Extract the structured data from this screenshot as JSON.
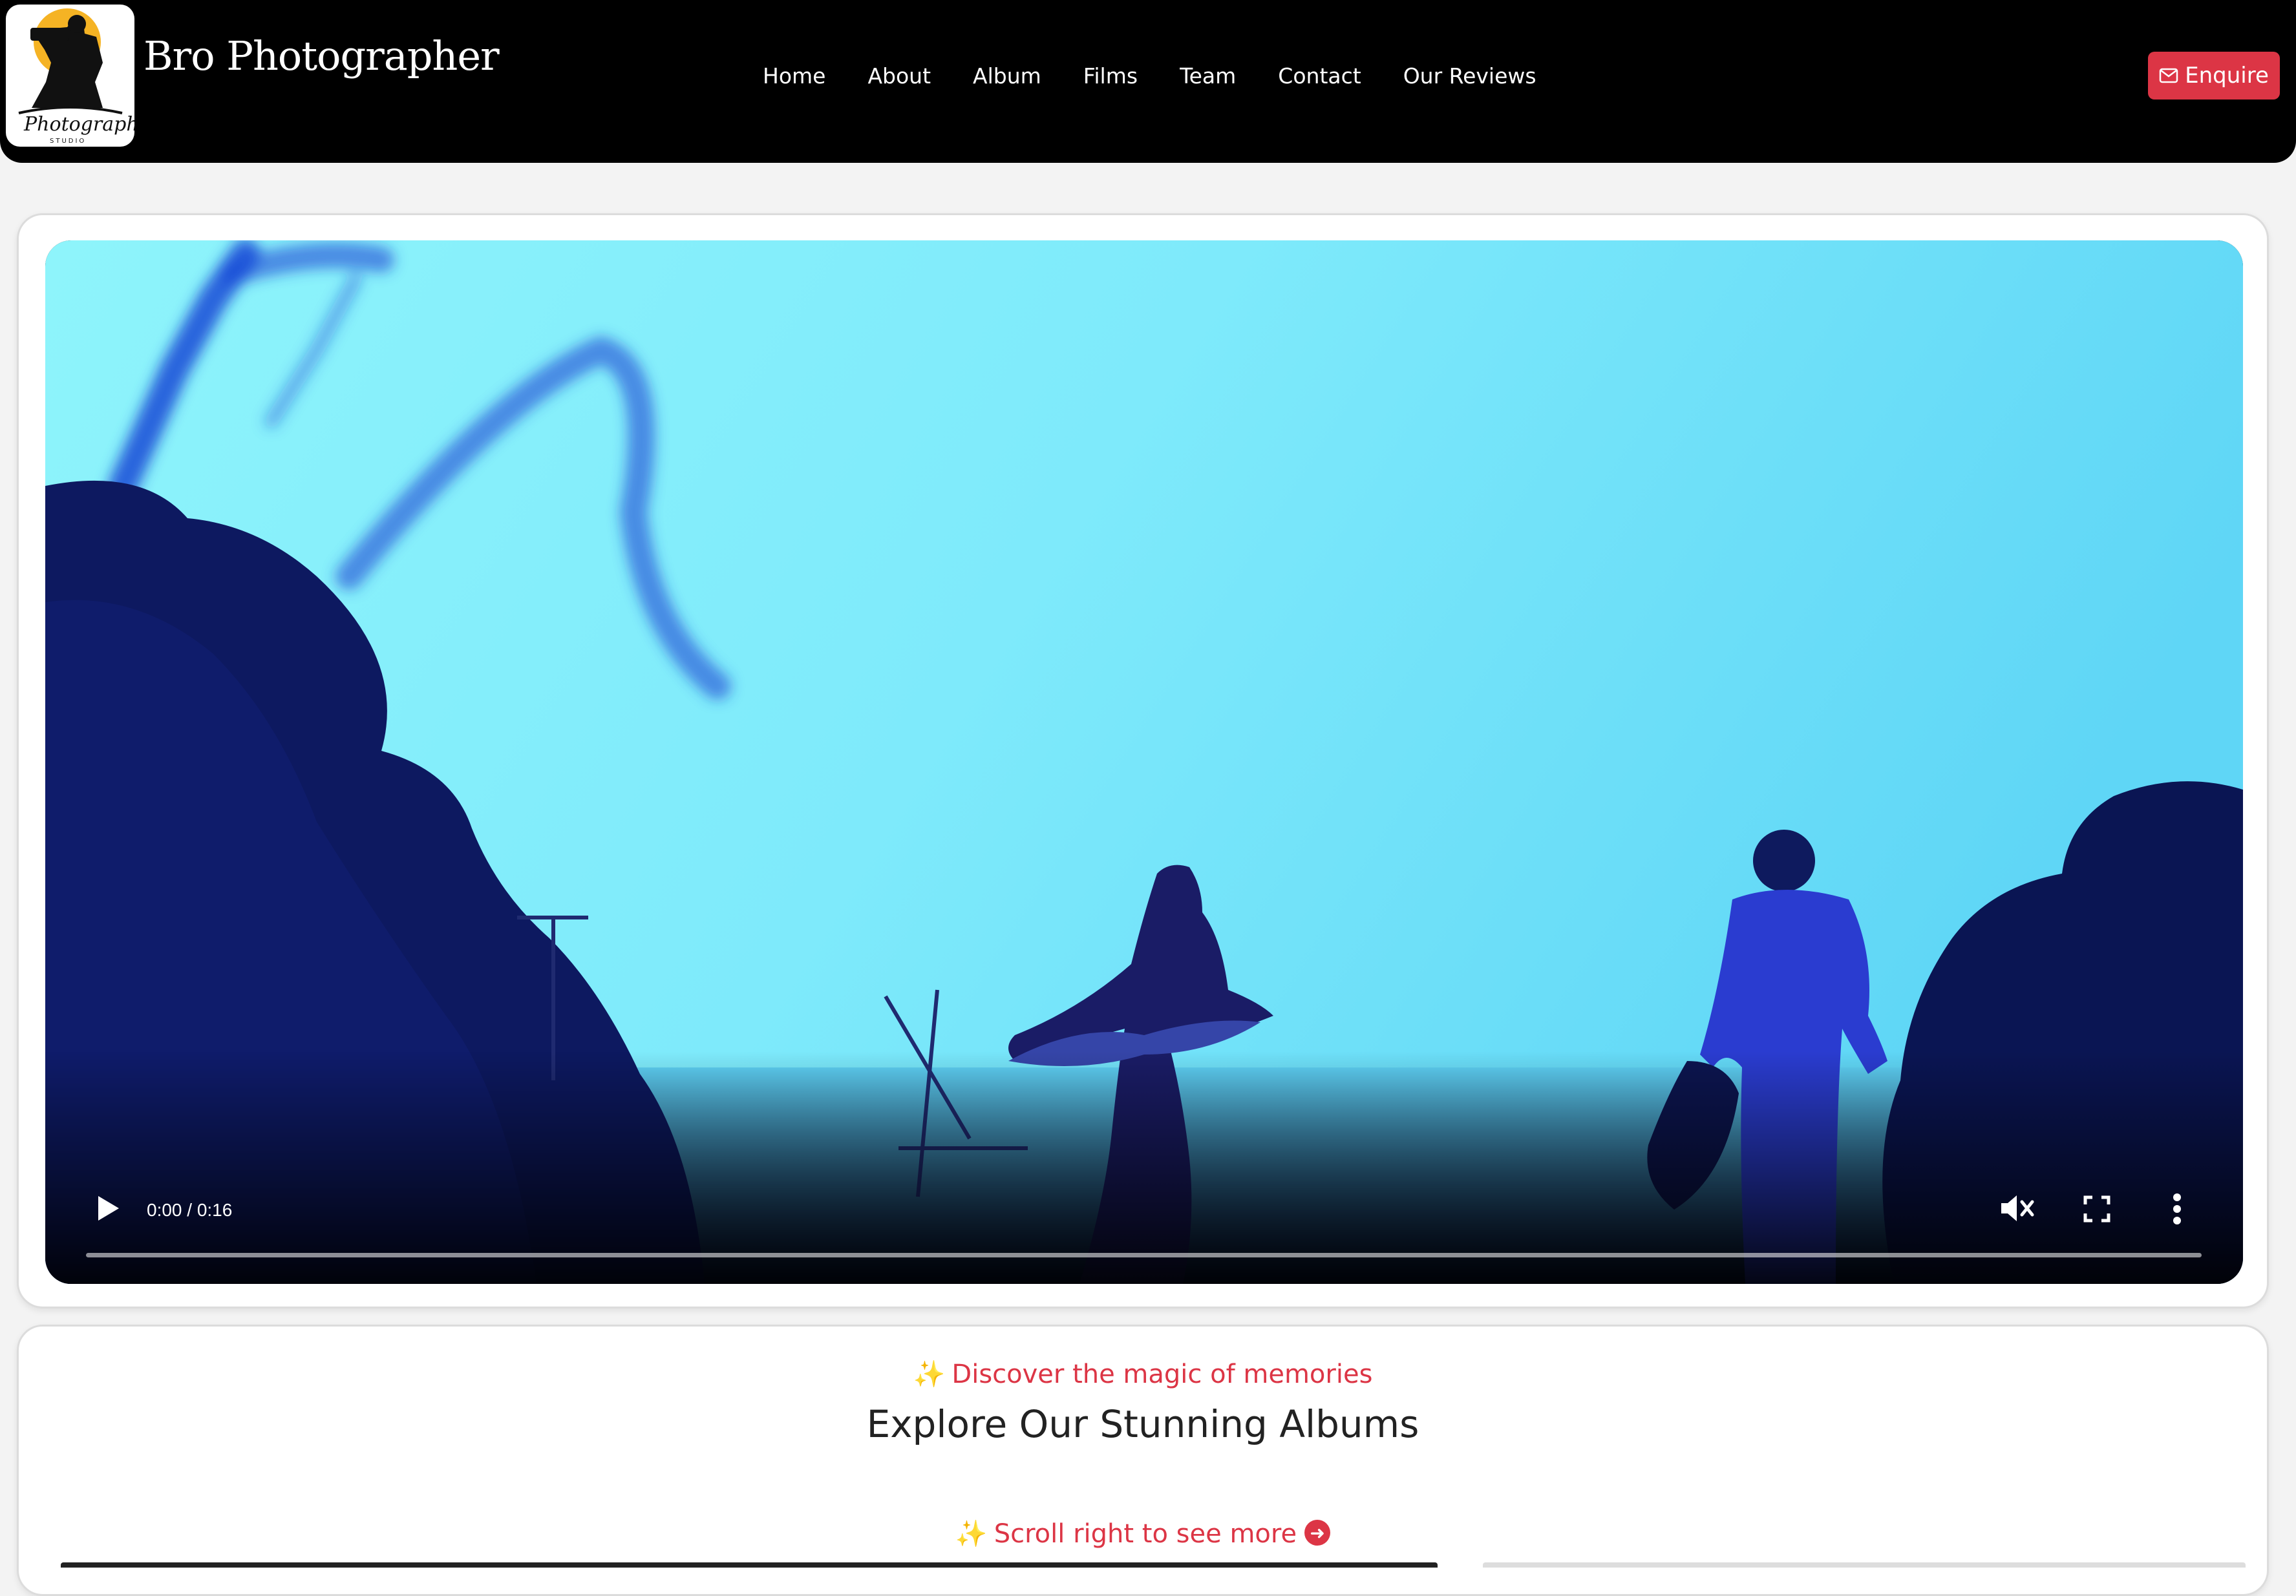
{
  "navbar": {
    "brand": "Bro Photographer",
    "logo_text": "Photography",
    "logo_subtext": "STUDIO",
    "links": [
      "Home",
      "About",
      "Album",
      "Films",
      "Team",
      "Contact",
      "Our Reviews"
    ],
    "enquire_label": "Enquire"
  },
  "video": {
    "time": "0:00 / 0:16",
    "progress_fraction": 0.0,
    "muted": true
  },
  "albums": {
    "tagline_icon": "✨",
    "tagline": "Discover the magic of memories",
    "title": "Explore Our Stunning Albums",
    "scroll_hint": "Scroll right to see more",
    "scroll_icon": "arrow-right-circle-icon"
  },
  "colors": {
    "accent": "#dc3545",
    "navbar_bg": "#000000",
    "sparkle": "#f4c542"
  }
}
